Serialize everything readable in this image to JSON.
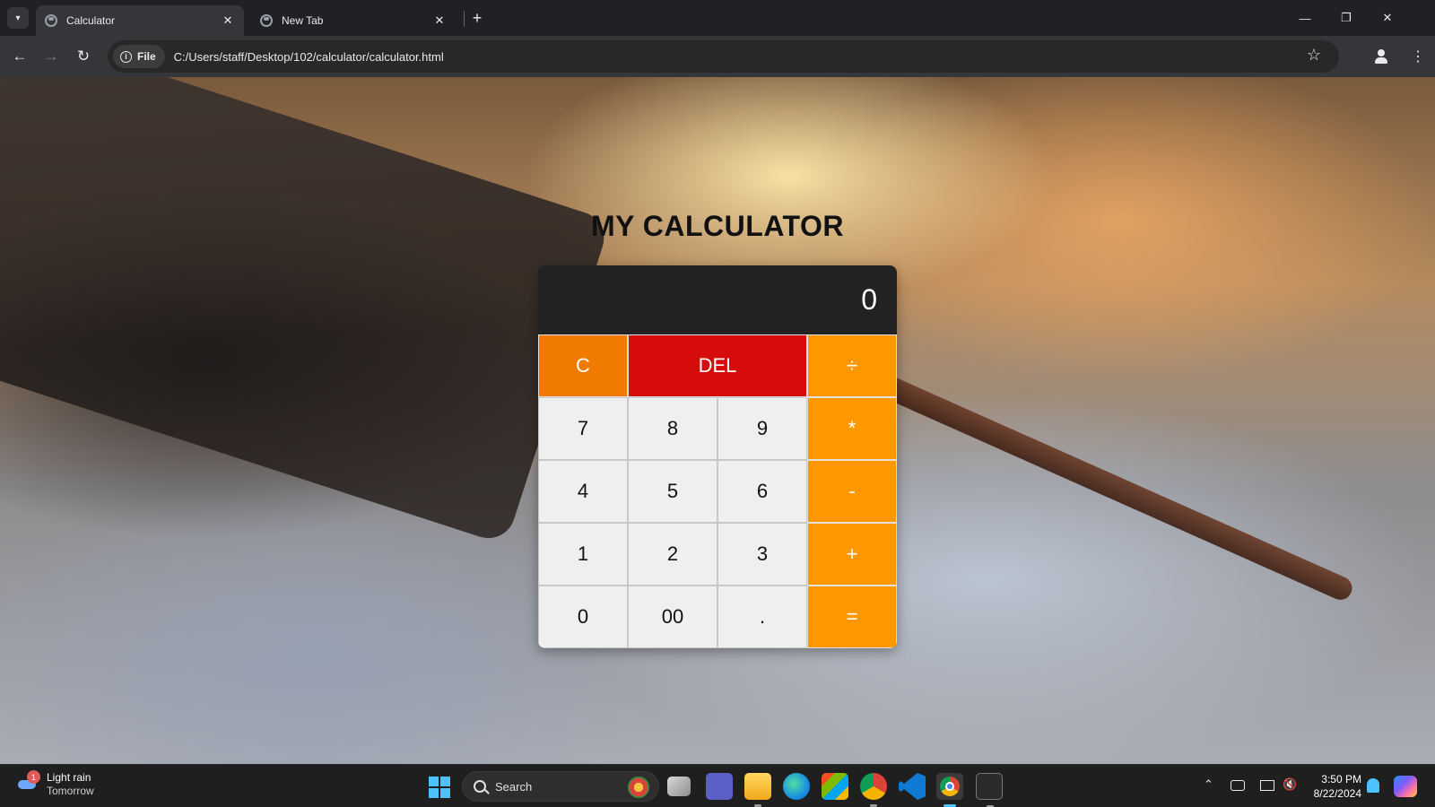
{
  "browser": {
    "tabs": [
      {
        "title": "Calculator",
        "close": "✕"
      },
      {
        "title": "New Tab",
        "close": "✕"
      }
    ],
    "new_tab": "+",
    "window_controls": {
      "minimize": "—",
      "restore": "❐",
      "close": "✕"
    },
    "toolbar": {
      "back": "←",
      "forward": "→",
      "reload": "↻",
      "chip_label": "File",
      "url": "C:/Users/staff/Desktop/102/calculator/calculator.html",
      "bookmark": "☆",
      "menu": "⋮"
    }
  },
  "page": {
    "title": "MY CALCULATOR",
    "display": "0",
    "keys": [
      {
        "label": "C",
        "kind": "clear"
      },
      {
        "label": "DEL",
        "kind": "del"
      },
      {
        "label": "÷",
        "kind": "op"
      },
      {
        "label": "7",
        "kind": "num"
      },
      {
        "label": "8",
        "kind": "num"
      },
      {
        "label": "9",
        "kind": "num"
      },
      {
        "label": "*",
        "kind": "op"
      },
      {
        "label": "4",
        "kind": "num"
      },
      {
        "label": "5",
        "kind": "num"
      },
      {
        "label": "6",
        "kind": "num"
      },
      {
        "label": "-",
        "kind": "op"
      },
      {
        "label": "1",
        "kind": "num"
      },
      {
        "label": "2",
        "kind": "num"
      },
      {
        "label": "3",
        "kind": "num"
      },
      {
        "label": "+",
        "kind": "op"
      },
      {
        "label": "0",
        "kind": "num"
      },
      {
        "label": "00",
        "kind": "num"
      },
      {
        "label": ".",
        "kind": "num"
      },
      {
        "label": "=",
        "kind": "op"
      }
    ],
    "colors": {
      "operator": "#ff9800",
      "clear": "#f07b00",
      "delete": "#d60c0c",
      "display": "#222222"
    }
  },
  "taskbar": {
    "weather": {
      "badge": "1",
      "line1": "Light rain",
      "line2": "Tomorrow"
    },
    "search_placeholder": "Search",
    "tray": {
      "chevron": "⌃",
      "mute": "🔇"
    },
    "clock": {
      "time": "3:50 PM",
      "date": "8/22/2024"
    }
  }
}
